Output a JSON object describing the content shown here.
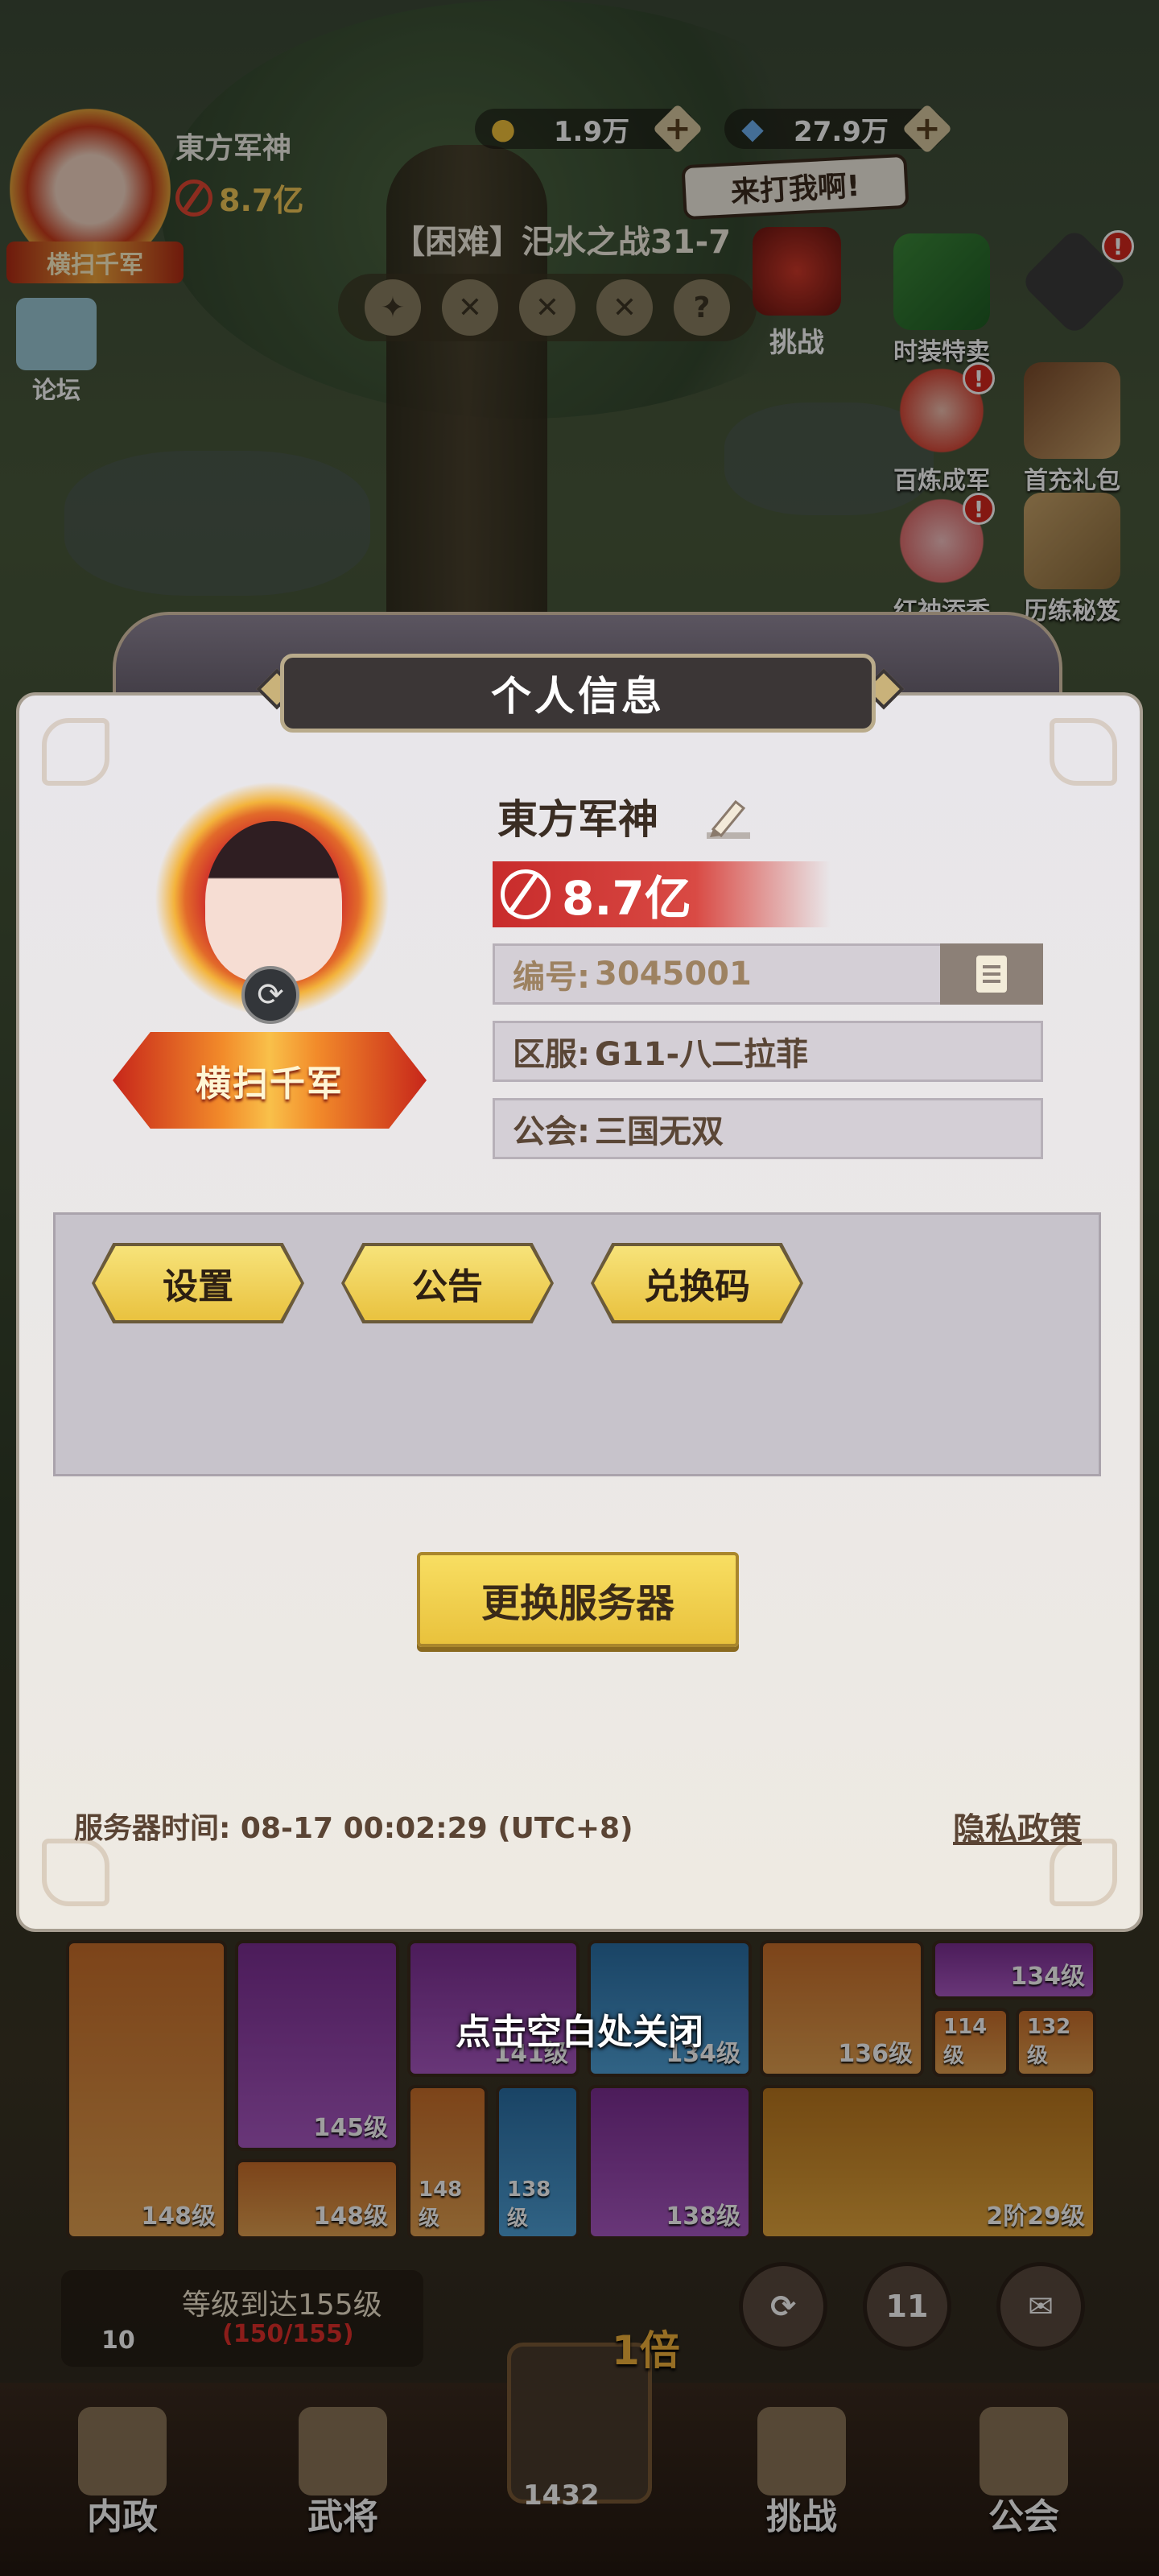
{
  "hud": {
    "player_name": "東方军神",
    "player_power": "8.7亿",
    "player_title": "横扫千军",
    "gold": "1.9万",
    "gems": "27.9万",
    "forum_label": "论坛",
    "stage_title": "【困难】汜水之战31-7",
    "speech": "来打我啊!",
    "challenge_label": "挑战",
    "stage_question": "?",
    "side_icons": [
      {
        "label": "时装特卖",
        "badge": ""
      },
      {
        "label": "",
        "badge": "!"
      },
      {
        "label": "百炼成军",
        "badge": "!"
      },
      {
        "label": "首充礼包",
        "badge": ""
      },
      {
        "label": "红袖添香",
        "badge": "!"
      },
      {
        "label": "历练秘笈",
        "badge": ""
      }
    ]
  },
  "modal": {
    "title": "个人信息",
    "name": "東方军神",
    "power": "8.7亿",
    "title_badge": "横扫千军",
    "id_label": "编号:",
    "id_value": "3045001",
    "server_label": "区服:",
    "server_value": "G11-八二拉菲",
    "guild_label": "公会:",
    "guild_value": "三国无双",
    "buttons": {
      "settings": "设置",
      "notice": "公告",
      "redeem": "兑换码"
    },
    "change_server": "更换服务器",
    "server_time": "服务器时间: 08-17 00:02:29 (UTC+8)",
    "privacy": "隐私政策",
    "close_hint": "点击空白处关闭"
  },
  "inventory": {
    "levels": [
      "148级",
      "145级",
      "141级",
      "134级",
      "136级",
      "134级",
      "114级",
      "132级",
      "148级",
      "148级",
      "138级",
      "138级",
      "2阶29级"
    ]
  },
  "quest": {
    "text": "等级到达155级",
    "progress": "(150/155)",
    "level": "10"
  },
  "bottom": {
    "tabs": [
      "内政",
      "武将",
      "挑战",
      "公会"
    ],
    "center_count": "1432",
    "multiplier": "1倍",
    "mail_count": "11"
  },
  "colors": {
    "accent_yellow": "#f3d452",
    "power_red": "#c82b2b",
    "badge_red": "#d6271d",
    "panel_bg": "#e9e6e8"
  }
}
